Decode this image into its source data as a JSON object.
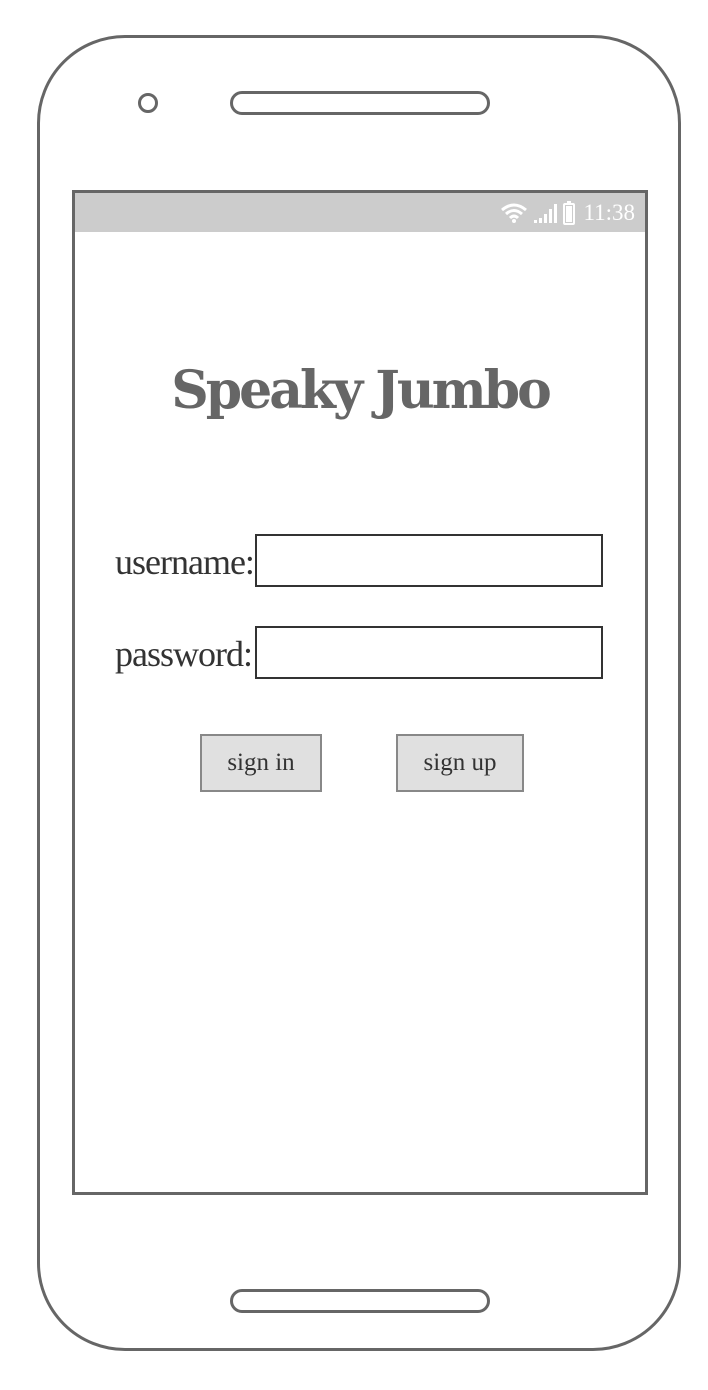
{
  "status_bar": {
    "time": "11:38",
    "icons": [
      "wifi-icon",
      "signal-icon",
      "battery-icon"
    ],
    "background_color": "#cccccc"
  },
  "app": {
    "title": "Speaky Jumbo"
  },
  "login_form": {
    "username_label": "username:",
    "username_value": "",
    "password_label": "password:",
    "password_value": "",
    "sign_in_label": "sign in",
    "sign_up_label": "sign up"
  },
  "colors": {
    "outline": "#666666",
    "button_fill": "#e0e0e0",
    "text": "#333333"
  }
}
